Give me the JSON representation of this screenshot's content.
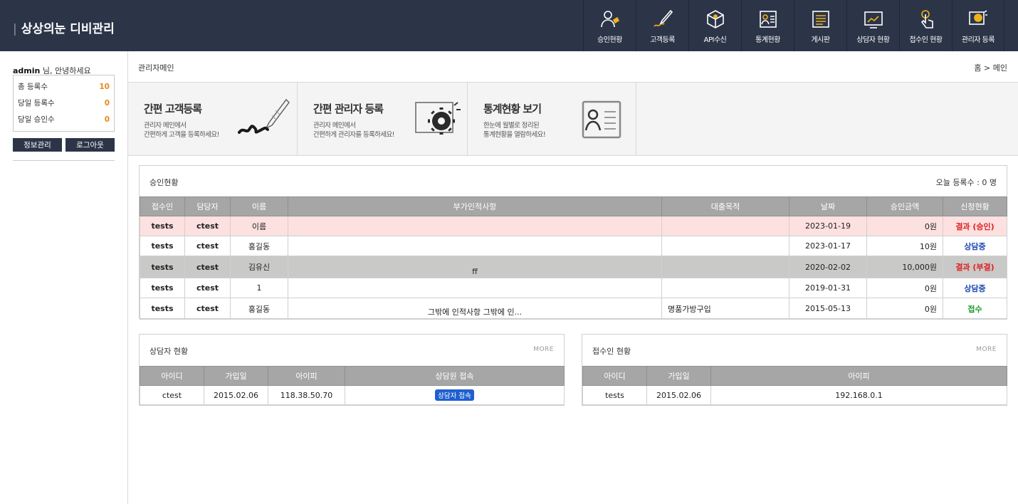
{
  "brand": {
    "bar": "|",
    "title": "상상의눈 디비관리"
  },
  "nav": [
    {
      "label": "승인현황",
      "icon": "user-approval-icon"
    },
    {
      "label": "고객등록",
      "icon": "pen-brush-icon"
    },
    {
      "label": "API수신",
      "icon": "box-icon"
    },
    {
      "label": "통계현황",
      "icon": "contact-card-icon"
    },
    {
      "label": "게시판",
      "icon": "board-list-icon"
    },
    {
      "label": "상담자 현황",
      "icon": "chart-screen-icon"
    },
    {
      "label": "접수인 현황",
      "icon": "touch-hand-icon"
    },
    {
      "label": "관리자 등록",
      "icon": "gear-screen-icon"
    }
  ],
  "sidebar": {
    "user": "admin",
    "greeting": " 님, 안녕하세요",
    "stats": [
      {
        "label": "총 등록수",
        "value": "10"
      },
      {
        "label": "당일 등록수",
        "value": "0"
      },
      {
        "label": "당일 승인수",
        "value": "0"
      }
    ],
    "info_button": "정보관리",
    "logout_button": "로그아웃"
  },
  "page": {
    "title": "관리자메인",
    "breadcrumb": "홈 > 메인"
  },
  "quick": [
    {
      "title": "간편 고객등록",
      "desc1": "관리자 메인에서",
      "desc2": "간편하게 고객을 등록하세요!"
    },
    {
      "title": "간편 관리자 등록",
      "desc1": "관리자 메인에서",
      "desc2": "간편하게 관리자를 등록하세요!"
    },
    {
      "title": "통계현황 보기",
      "desc1": "한눈에 월별로 정리된",
      "desc2": "통계현황을 열람하세요!"
    }
  ],
  "approval": {
    "title": "승인현황",
    "today": "오늘 등록수 : 0 명",
    "headers": [
      "접수인",
      "담당자",
      "이름",
      "부가인적사항",
      "대출목적",
      "날짜",
      "승인금액",
      "신청현황"
    ],
    "rows": [
      {
        "receiver": "tests",
        "manager": "ctest",
        "name": "이름",
        "extra": "",
        "purpose": "",
        "date": "2023-01-19",
        "amount": "0원",
        "status": "결과 (승인)"
      },
      {
        "receiver": "tests",
        "manager": "ctest",
        "name": "홍길동",
        "extra": "",
        "purpose": "",
        "date": "2023-01-17",
        "amount": "10원",
        "status": "상담중"
      },
      {
        "receiver": "tests",
        "manager": "ctest",
        "name": "김유신",
        "extra": "ff",
        "purpose": "",
        "date": "2020-02-02",
        "amount": "10,000원",
        "status": "결과 (부결)"
      },
      {
        "receiver": "tests",
        "manager": "ctest",
        "name": "1",
        "extra": "",
        "purpose": "",
        "date": "2019-01-31",
        "amount": "0원",
        "status": "상담중"
      },
      {
        "receiver": "tests",
        "manager": "ctest",
        "name": "홍길동",
        "extra": "그밖에 인적사항 그밖에 인...",
        "purpose": "명품가방구입",
        "date": "2015-05-13",
        "amount": "0원",
        "status": "접수"
      }
    ]
  },
  "counselors": {
    "title": "상담자 현황",
    "more": "MORE",
    "headers": [
      "아이디",
      "가입일",
      "아이피",
      "상담원 접속"
    ],
    "rows": [
      {
        "id": "ctest",
        "joined": "2015.02.06",
        "ip": "118.38.50.70",
        "action": "상담자 접속"
      }
    ]
  },
  "receivers": {
    "title": "접수인 현황",
    "more": "MORE",
    "headers": [
      "아이디",
      "가입일",
      "아이피"
    ],
    "rows": [
      {
        "id": "tests",
        "joined": "2015.02.06",
        "ip": "192.168.0.1"
      }
    ]
  },
  "colors": {
    "header_bg": "#2c3548",
    "accent_orange": "#e68a1a",
    "pink_row": "#fde0e0",
    "gray_row": "#c9c9c7"
  }
}
